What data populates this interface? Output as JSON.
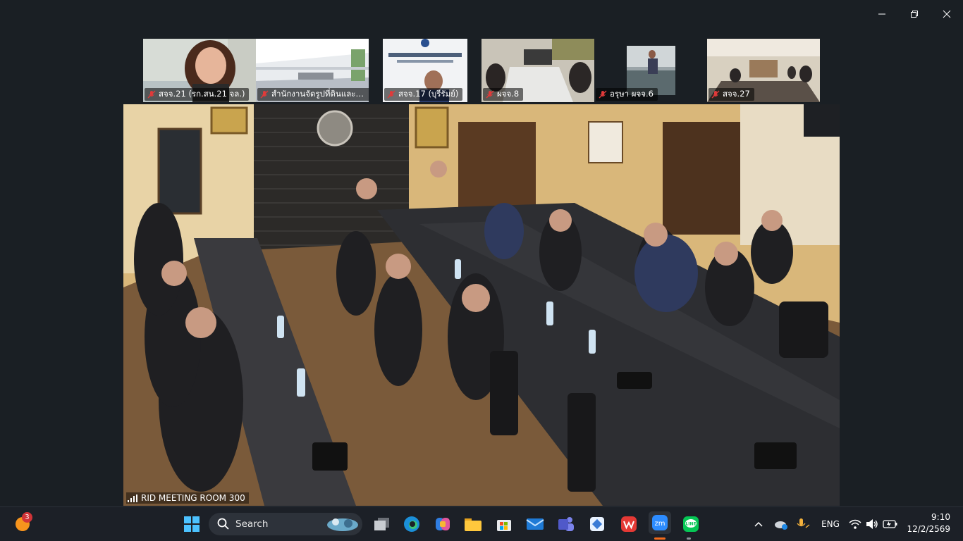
{
  "window_controls": {
    "minimize": "minimize",
    "restore": "restore",
    "close": "close"
  },
  "participants": [
    {
      "name": "สจจ.21 (รก.สน.21 จล.)"
    },
    {
      "name": "สำนักงานจัดรูปที่ดินและเก..."
    },
    {
      "name": "สจจ.17 (บุรีรัมย์)"
    },
    {
      "name": "ผจจ.8"
    },
    {
      "name": "อรุษา ผจจ.6"
    },
    {
      "name": "สจจ.27"
    }
  ],
  "main_video": {
    "room_name": "RID MEETING ROOM 300"
  },
  "taskbar": {
    "notification_count": "3",
    "search_label": "Search",
    "language": "ENG",
    "time": "9:10",
    "date": "12/2/2569",
    "apps": [
      "windows-start",
      "search",
      "task-view",
      "edge",
      "copilot",
      "file-explorer",
      "microsoft-store",
      "mail",
      "teams",
      "app-generic",
      "wps-office",
      "zoom",
      "line"
    ]
  }
}
